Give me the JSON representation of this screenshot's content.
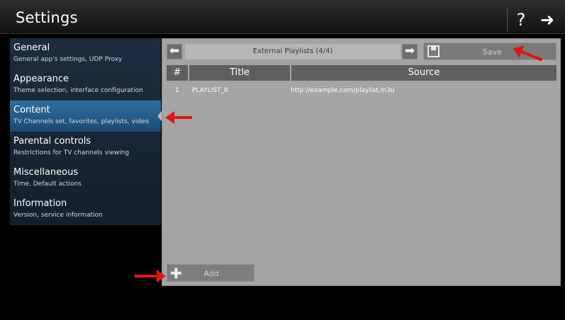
{
  "header": {
    "title": "Settings",
    "help_icon": "?",
    "forward_icon": "➜"
  },
  "sidebar": {
    "items": [
      {
        "title": "General",
        "subtitle": "General app's settings, UDP Proxy"
      },
      {
        "title": "Appearance",
        "subtitle": "Theme selection, interface configuration"
      },
      {
        "title": "Content",
        "subtitle": "TV Channels set, favorites, playlists, video"
      },
      {
        "title": "Parental controls",
        "subtitle": "Restrictions for TV channels viewing"
      },
      {
        "title": "Miscellaneous",
        "subtitle": "Time, Default actions"
      },
      {
        "title": "Information",
        "subtitle": "Version, service information"
      }
    ]
  },
  "panel": {
    "playlist_label": "External Playlists (4/4)",
    "prev_icon": "⬅",
    "next_icon": "➡",
    "save_label": "Save",
    "add_label": "Add",
    "add_icon": "✚",
    "table": {
      "columns": [
        "#",
        "Title",
        "Source"
      ],
      "rows": [
        {
          "index": "1",
          "title": "PLAYLIST_0",
          "source": "http://example,com/playlist,m3u"
        }
      ]
    }
  },
  "colors": {
    "accent": "#2e6fa0",
    "annotation": "#e0160f"
  }
}
